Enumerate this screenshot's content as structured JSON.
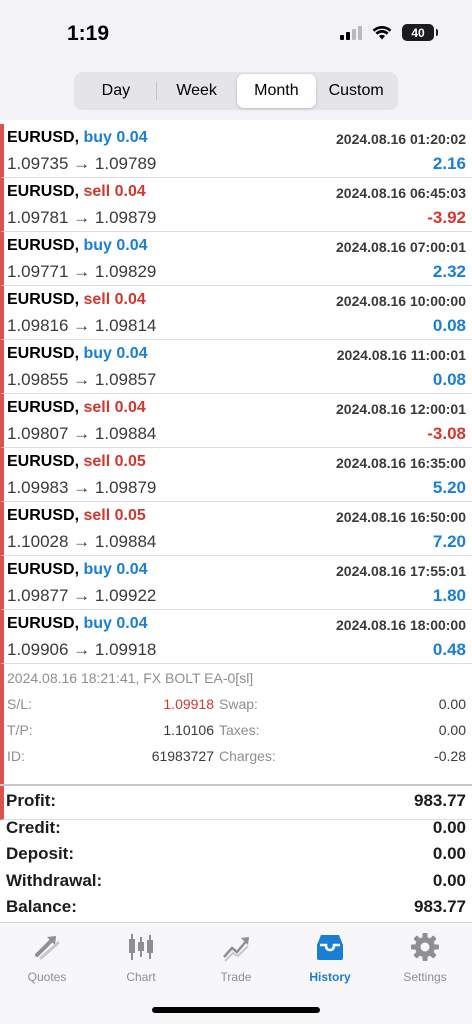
{
  "status_bar": {
    "time": "1:19",
    "battery": "40"
  },
  "periods": [
    {
      "label": "Day",
      "active": false
    },
    {
      "label": "Week",
      "active": false
    },
    {
      "label": "Month",
      "active": true
    },
    {
      "label": "Custom",
      "active": false
    }
  ],
  "deals": [
    {
      "symbol": "EURUSD,",
      "side": "buy 0.04",
      "type": "buy",
      "datetime": "2024.08.16 01:20:02",
      "prices": "1.09735 → 1.09789",
      "profit": "2.16",
      "sign": "pos"
    },
    {
      "symbol": "EURUSD,",
      "side": "sell 0.04",
      "type": "sell",
      "datetime": "2024.08.16 06:45:03",
      "prices": "1.09781 → 1.09879",
      "profit": "-3.92",
      "sign": "neg"
    },
    {
      "symbol": "EURUSD,",
      "side": "buy 0.04",
      "type": "buy",
      "datetime": "2024.08.16 07:00:01",
      "prices": "1.09771 → 1.09829",
      "profit": "2.32",
      "sign": "pos"
    },
    {
      "symbol": "EURUSD,",
      "side": "sell 0.04",
      "type": "sell",
      "datetime": "2024.08.16 10:00:00",
      "prices": "1.09816 → 1.09814",
      "profit": "0.08",
      "sign": "pos"
    },
    {
      "symbol": "EURUSD,",
      "side": "buy 0.04",
      "type": "buy",
      "datetime": "2024.08.16 11:00:01",
      "prices": "1.09855 → 1.09857",
      "profit": "0.08",
      "sign": "pos"
    },
    {
      "symbol": "EURUSD,",
      "side": "sell 0.04",
      "type": "sell",
      "datetime": "2024.08.16 12:00:01",
      "prices": "1.09807 → 1.09884",
      "profit": "-3.08",
      "sign": "neg"
    },
    {
      "symbol": "EURUSD,",
      "side": "sell 0.05",
      "type": "sell",
      "datetime": "2024.08.16 16:35:00",
      "prices": "1.09983 → 1.09879",
      "profit": "5.20",
      "sign": "pos"
    },
    {
      "symbol": "EURUSD,",
      "side": "sell 0.05",
      "type": "sell",
      "datetime": "2024.08.16 16:50:00",
      "prices": "1.10028 → 1.09884",
      "profit": "7.20",
      "sign": "pos"
    },
    {
      "symbol": "EURUSD,",
      "side": "buy 0.04",
      "type": "buy",
      "datetime": "2024.08.16 17:55:01",
      "prices": "1.09877 → 1.09922",
      "profit": "1.80",
      "sign": "pos"
    },
    {
      "symbol": "EURUSD,",
      "side": "buy 0.04",
      "type": "buy",
      "datetime": "2024.08.16 18:00:00",
      "prices": "1.09906 → 1.09918",
      "profit": "0.48",
      "sign": "pos"
    }
  ],
  "detail": {
    "comment": "2024.08.16 18:21:41, FX BOLT EA-0[sl]",
    "sl_label": "S/L:",
    "sl_value": "1.09918",
    "swap_label": "Swap:",
    "swap_value": "0.00",
    "tp_label": "T/P:",
    "tp_value": "1.10106",
    "taxes_label": "Taxes:",
    "taxes_value": "0.00",
    "id_label": "ID:",
    "id_value": "61983727",
    "charges_label": "Charges:",
    "charges_value": "-0.28"
  },
  "summary": [
    {
      "label": "Profit:",
      "value": "983.77"
    },
    {
      "label": "Credit:",
      "value": "0.00"
    },
    {
      "label": "Deposit:",
      "value": "0.00"
    },
    {
      "label": "Withdrawal:",
      "value": "0.00"
    },
    {
      "label": "Balance:",
      "value": "983.77"
    }
  ],
  "tabs": [
    {
      "label": "Quotes",
      "icon": "quotes-icon",
      "active": false
    },
    {
      "label": "Chart",
      "icon": "chart-icon",
      "active": false
    },
    {
      "label": "Trade",
      "icon": "trade-icon",
      "active": false
    },
    {
      "label": "History",
      "icon": "history-icon",
      "active": true
    },
    {
      "label": "Settings",
      "icon": "settings-icon",
      "active": false
    }
  ],
  "colors": {
    "buy": "#1a7fd4",
    "sell": "#d4372c",
    "accent": "#1a7fd4"
  }
}
